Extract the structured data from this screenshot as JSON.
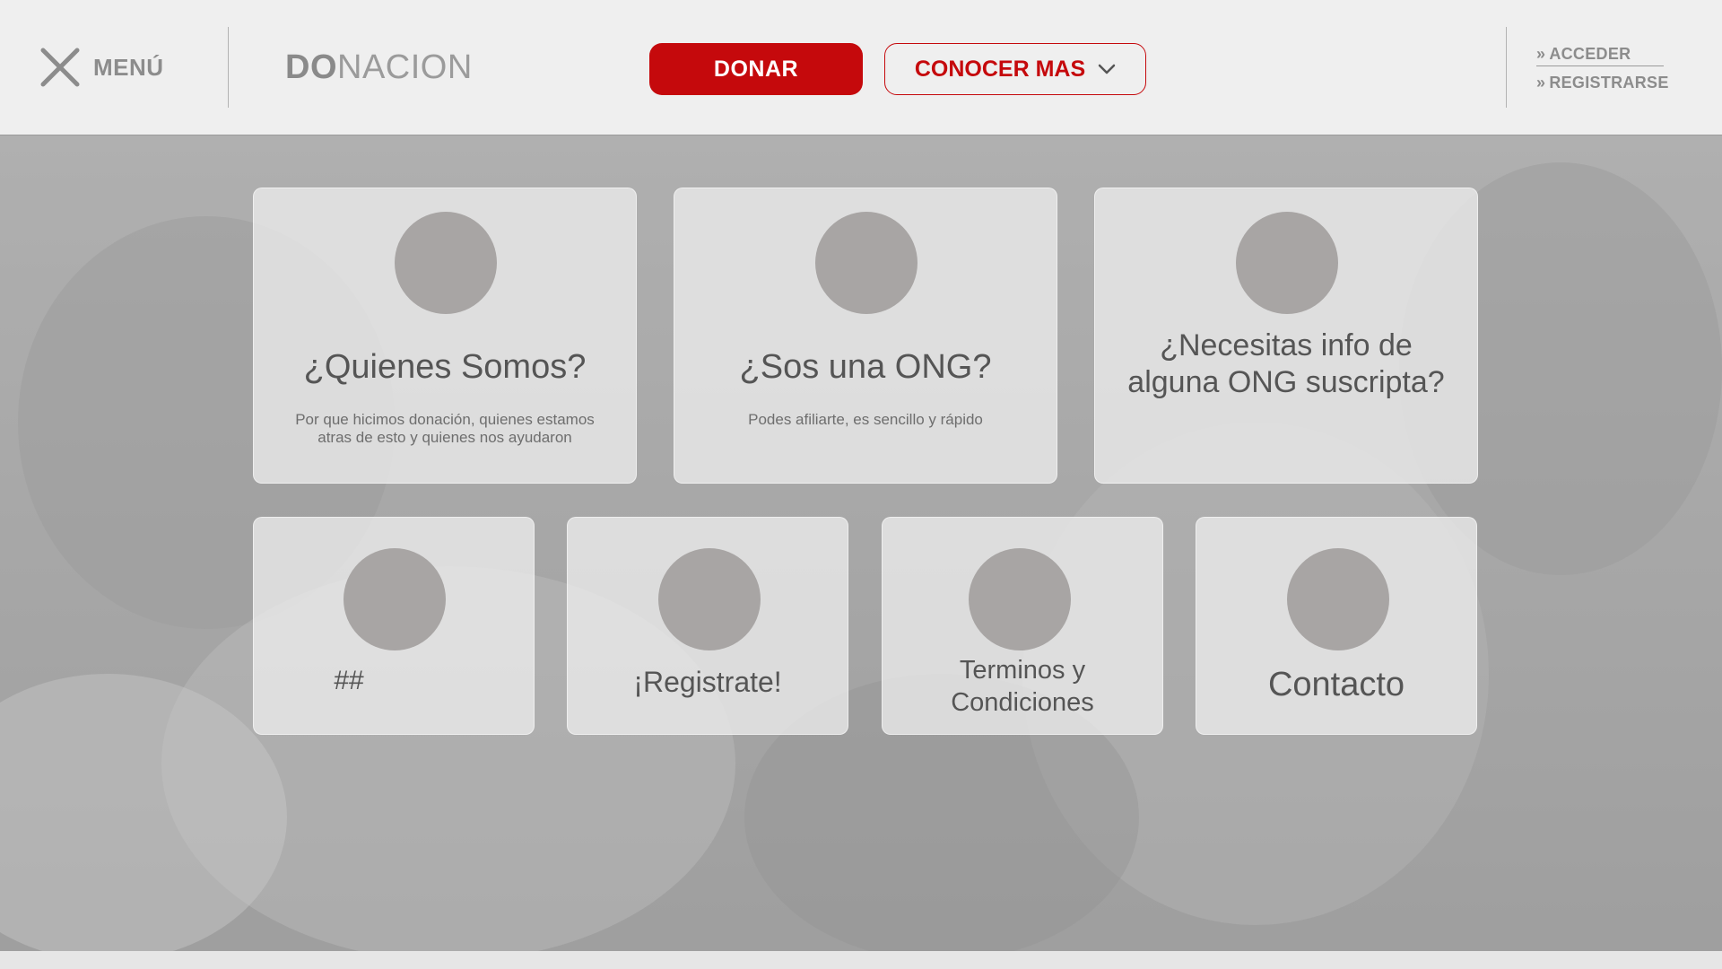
{
  "header": {
    "menu_label": "MENÚ",
    "brand_strong": "DO",
    "brand_rest": "NACION",
    "donate_label": "DONAR",
    "learn_more_label": "CONOCER MAS",
    "auth": [
      {
        "arrow": "»",
        "label": "ACCEDER"
      },
      {
        "arrow": "»",
        "label": "REGISTRARSE"
      }
    ]
  },
  "cards_top": [
    {
      "title": "¿Quienes Somos?",
      "description": "Por que hicimos donación, quienes estamos atras de esto y quienes nos ayudaron"
    },
    {
      "title": "¿Sos una ONG?",
      "description": "Podes afiliarte, es sencillo y rápido"
    },
    {
      "title": "¿Necesitas info de alguna ONG suscripta?",
      "description": ""
    }
  ],
  "cards_bottom": [
    {
      "title": "##"
    },
    {
      "title": "¡Registrate!"
    },
    {
      "title": "Terminos y Condiciones"
    },
    {
      "title": "Contacto"
    }
  ],
  "colors": {
    "accent": "#c5090c",
    "avatar": "#a8a5a4",
    "header_bg": "#efefef"
  },
  "icons": [
    "close-icon",
    "chevron-down-icon"
  ]
}
